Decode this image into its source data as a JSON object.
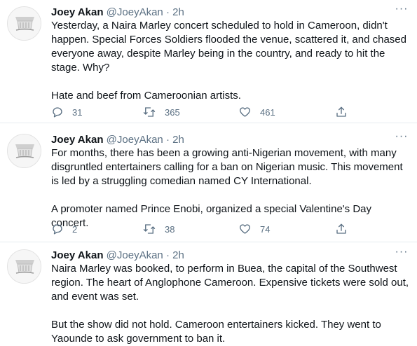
{
  "tweets": [
    {
      "name": "Joey Akan",
      "handle": "@JoeyAkan",
      "dot": "·",
      "time": "2h",
      "more": "···",
      "paragraphs": [
        "Yesterday, a Naira Marley concert scheduled to hold in Cameroon, didn't happen. Special Forces Soldiers flooded the venue, scattered it, and chased everyone away, despite Marley being in the country, and ready to hit the stage. Why?",
        "Hate and beef from Cameroonian artists."
      ],
      "replies": "31",
      "retweets": "365",
      "likes": "461"
    },
    {
      "name": "Joey Akan",
      "handle": "@JoeyAkan",
      "dot": "·",
      "time": "2h",
      "more": "···",
      "paragraphs": [
        "For months, there has been a growing anti-Nigerian movement, with many disgruntled entertainers calling for a ban on Nigerian music. This movement is led by a struggling comedian named CY International.",
        "A promoter named Prince Enobi, organized a special Valentine's Day concert."
      ],
      "replies": "2",
      "retweets": "38",
      "likes": "74"
    },
    {
      "name": "Joey Akan",
      "handle": "@JoeyAkan",
      "dot": "·",
      "time": "2h",
      "more": "···",
      "paragraphs": [
        "Naira Marley was booked, to perform in Buea, the capital of the Southwest region. The heart of Anglophone Cameroon. Expensive tickets were sold out, and event was set.",
        "But the show did not hold. Cameroon entertainers kicked. They went to Yaounde to ask government to ban it."
      ]
    }
  ],
  "icons": {
    "reply": "reply-icon",
    "retweet": "retweet-icon",
    "like": "like-icon",
    "share": "share-icon",
    "avatar": "avatar-image"
  },
  "colors": {
    "text": "#0f1419",
    "secondary": "#5b7083",
    "divider": "#e6ecf0"
  }
}
